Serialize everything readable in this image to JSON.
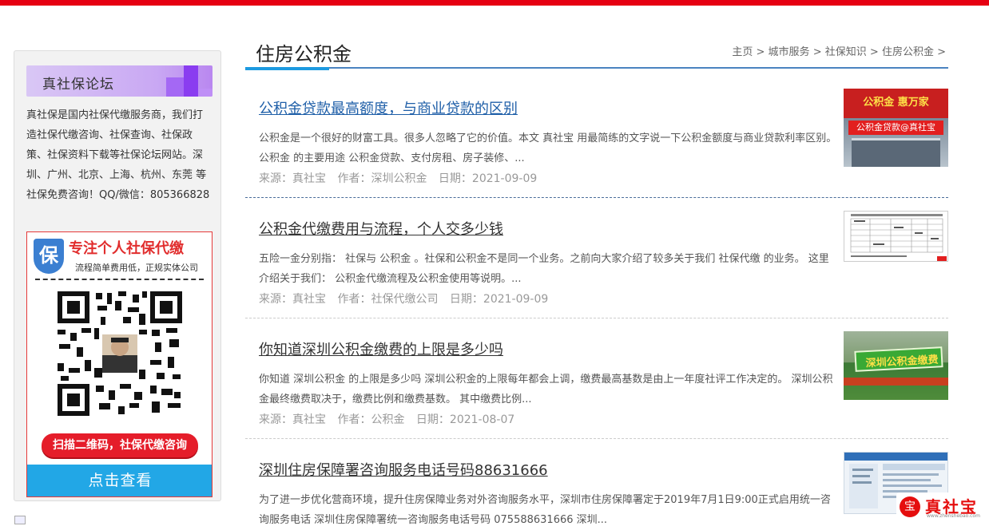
{
  "sidebar": {
    "forum_title": "真社保论坛",
    "description": "真社保是国内社保代缴服务商，我们打造社保代缴咨询、社保查询、社保政策、社保资料下载等社保论坛网站。深圳、广州、北京、上海、杭州、东莞 等社保免费咨询！QQ/微信：805366828",
    "ad": {
      "shield_char": "保",
      "title": "专注个人社保代缴",
      "subtitle": "流程简单费用低，正规实体公司",
      "pill": "扫描二维码，社保代缴咨询",
      "button": "点击查看"
    }
  },
  "header": {
    "title": "住房公积金",
    "breadcrumb": [
      "主页",
      "城市服务",
      "社保知识",
      "住房公积金"
    ],
    "separator": ">"
  },
  "articles": [
    {
      "title": "公积金贷款最高额度，与商业贷款的区别",
      "excerpt": "公积金是一个很好的财富工具。很多人忽略了它的价值。本文 真社宝 用最简练的文字说一下公积金额度与商业贷款利率区别。 公积金 的主要用途 公积金贷款、支付房租、房子装修、...",
      "source": "来源：真社宝",
      "author": "作者：深圳公积金",
      "date": "日期：2021-09-09",
      "thumb_text_1": "公积金 惠万家",
      "thumb_text_2": "公积金贷款@真社宝"
    },
    {
      "title": "公积金代缴费用与流程，个人交多少钱",
      "excerpt": "五险一金分别指： 社保与 公积金 。社保和公积金不是同一个业务。之前向大家介绍了较多关于我们 社保代缴 的业务。 这里介绍关于我们： 公积金代缴流程及公积金使用等说明。...",
      "source": "来源：真社宝",
      "author": "作者：社保代缴公司",
      "date": "日期：2021-09-09"
    },
    {
      "title": "你知道深圳公积金缴费的上限是多少吗",
      "excerpt": "你知道 深圳公积金 的上限是多少吗 深圳公积金的上限每年都会上调，缴费最高基数是由上一年度社评工作决定的。 深圳公积金最终缴费取决于，缴费比例和缴费基数。 其中缴费比例...",
      "source": "来源：真社宝",
      "author": "作者：公积金",
      "date": "日期：2021-08-07",
      "thumb_text_1": "深圳公积金缴费"
    },
    {
      "title": "深圳住房保障署咨询服务电话号码88631666",
      "excerpt": "为了进一步优化营商环境，提升住房保障业务对外咨询服务水平，深圳市住房保障署定于2019年7月1日9:00正式启用统一咨询服务电话 深圳住房保障署统一咨询服务电话号码 075588631666 深圳...",
      "source": "",
      "author": "",
      "date": ""
    }
  ],
  "logo": {
    "mark": "宝",
    "text": "真社宝",
    "url": "www.zhenshebao.com"
  },
  "colors": {
    "brand_red": "#e60012",
    "accent_blue": "#1d9ae0",
    "link_blue": "#1f5fa8",
    "button_blue": "#22a7e6"
  }
}
